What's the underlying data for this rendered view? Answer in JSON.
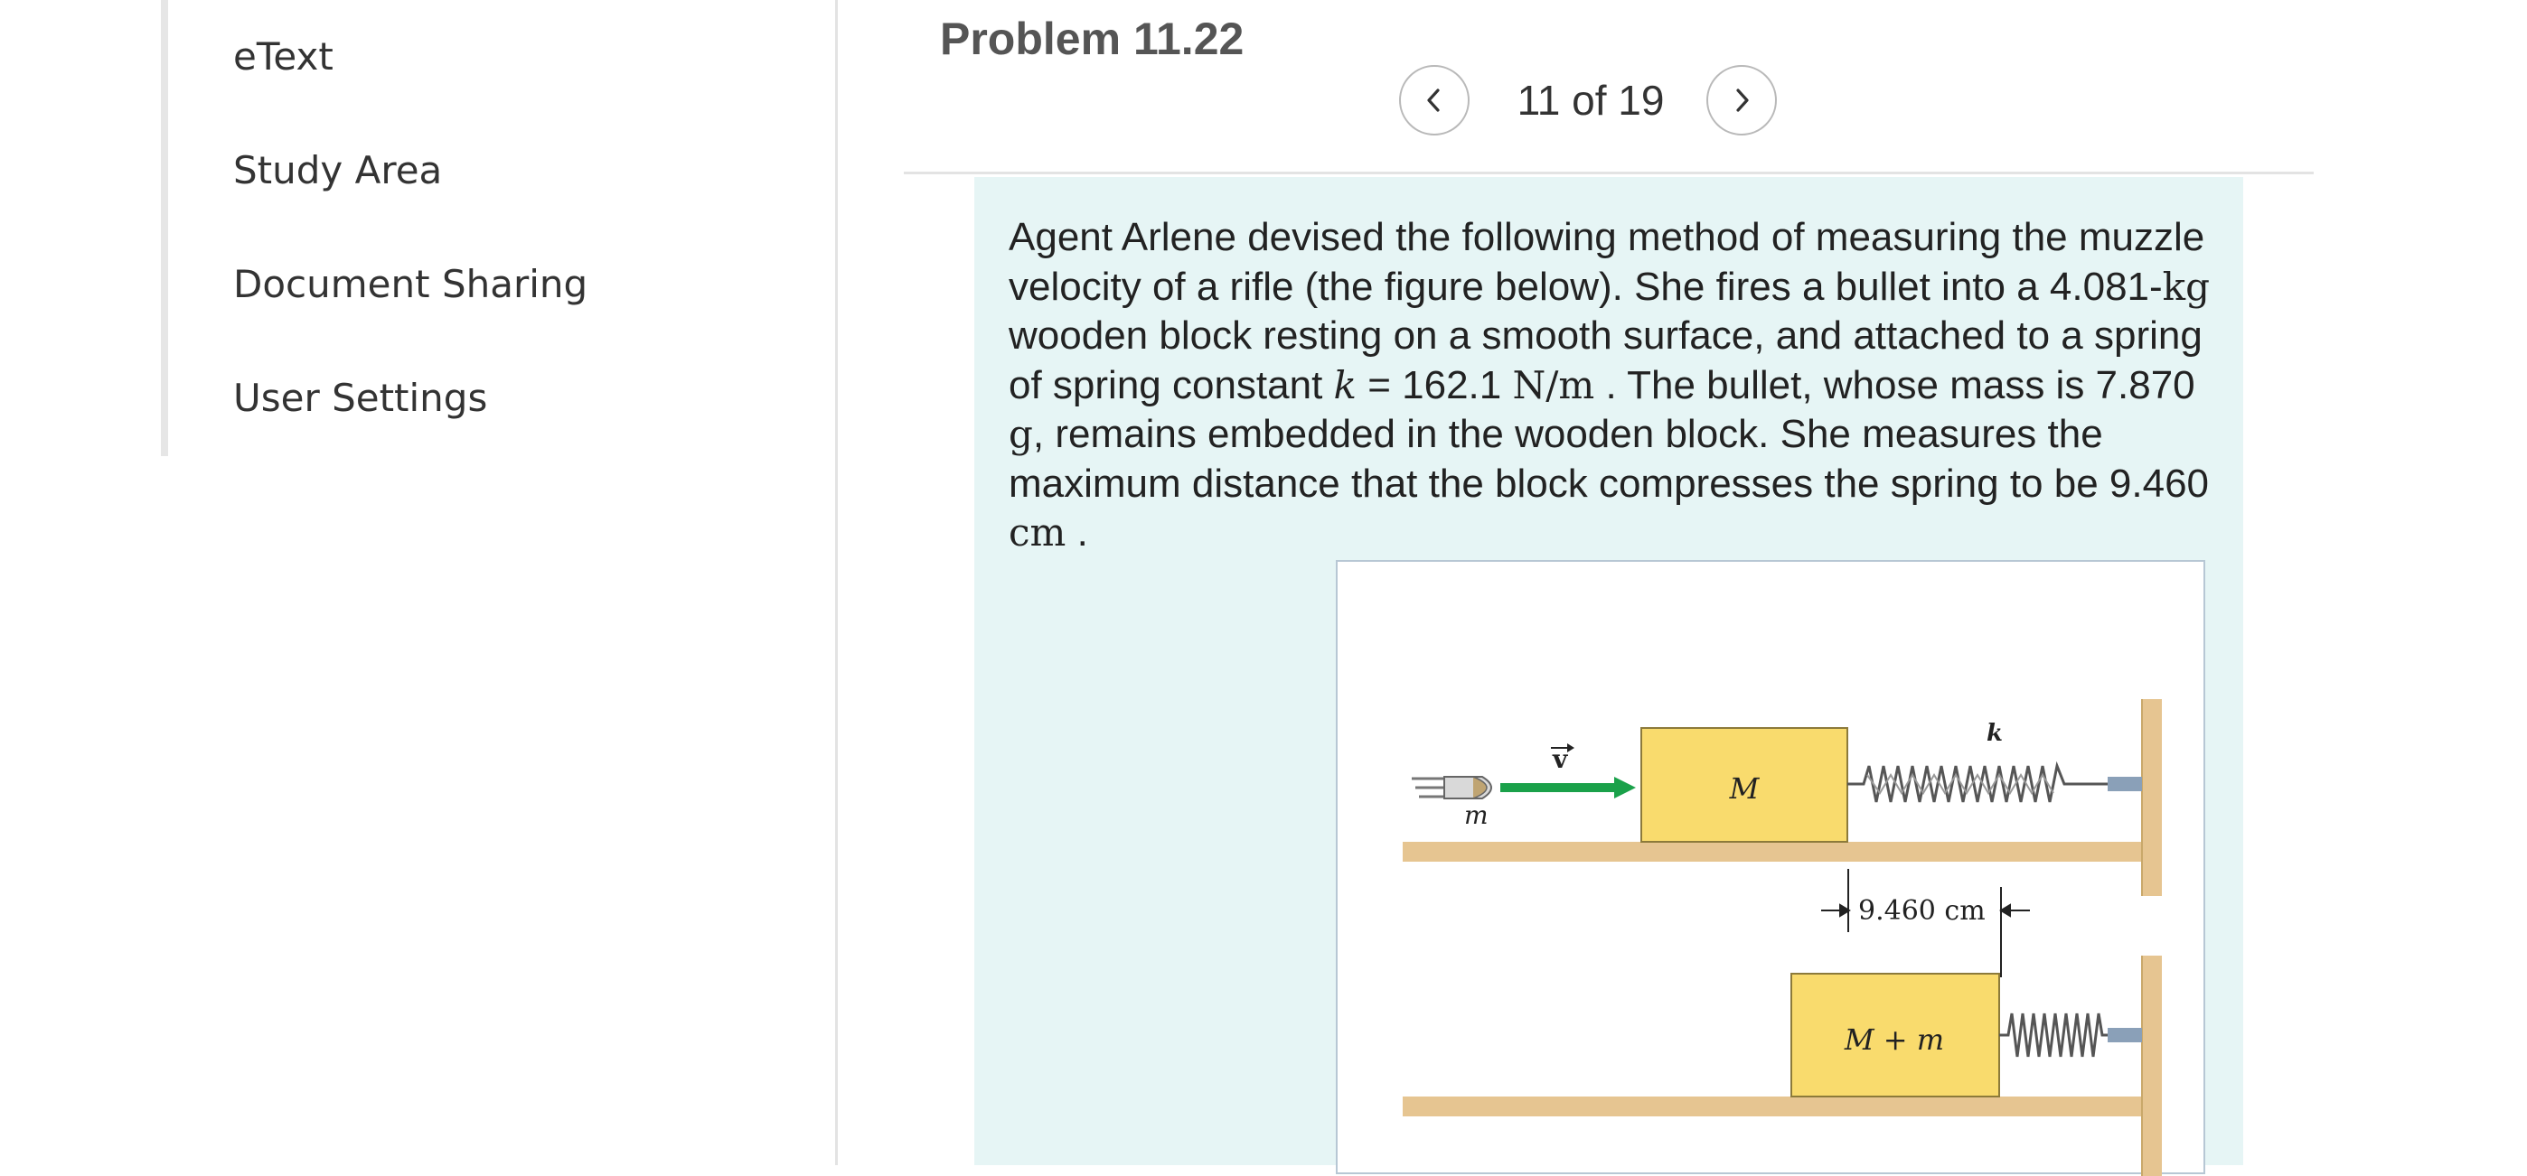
{
  "sidebar": {
    "items": [
      {
        "label": "eText"
      },
      {
        "label": "Study Area"
      },
      {
        "label": "Document Sharing"
      },
      {
        "label": "User Settings"
      }
    ]
  },
  "problem": {
    "title": "Problem 11.22",
    "pager": {
      "text": "11 of 19",
      "prev_icon": "chevron-left-icon",
      "next_icon": "chevron-right-icon"
    },
    "prompt": {
      "p1": "Agent Arlene devised the following method of measuring the muzzle velocity of a rifle (the figure below). She fires a bullet into a 4.081-",
      "kg": "kg",
      "p2": " wooden block resting on a smooth surface, and attached to a spring of spring constant ",
      "k": "k",
      "eq": " = 162.1 ",
      "nm": "N/m",
      "p3": " . The bullet, whose mass is 7.870 ",
      "g": "g",
      "p4": ", remains embedded in the wooden block. She measures the maximum distance that the block compresses the spring to be 9.460 ",
      "cm": "cm",
      "p5": " ."
    }
  },
  "figure": {
    "labels": {
      "bullet_mass": "m",
      "velocity": "v",
      "block": "M",
      "spring_constant": "k",
      "compression": "9.460 cm",
      "combined": "M + m"
    },
    "colors": {
      "block": "#f9db6d",
      "floor": "#e6c591",
      "arrow": "#1aa14a"
    }
  }
}
